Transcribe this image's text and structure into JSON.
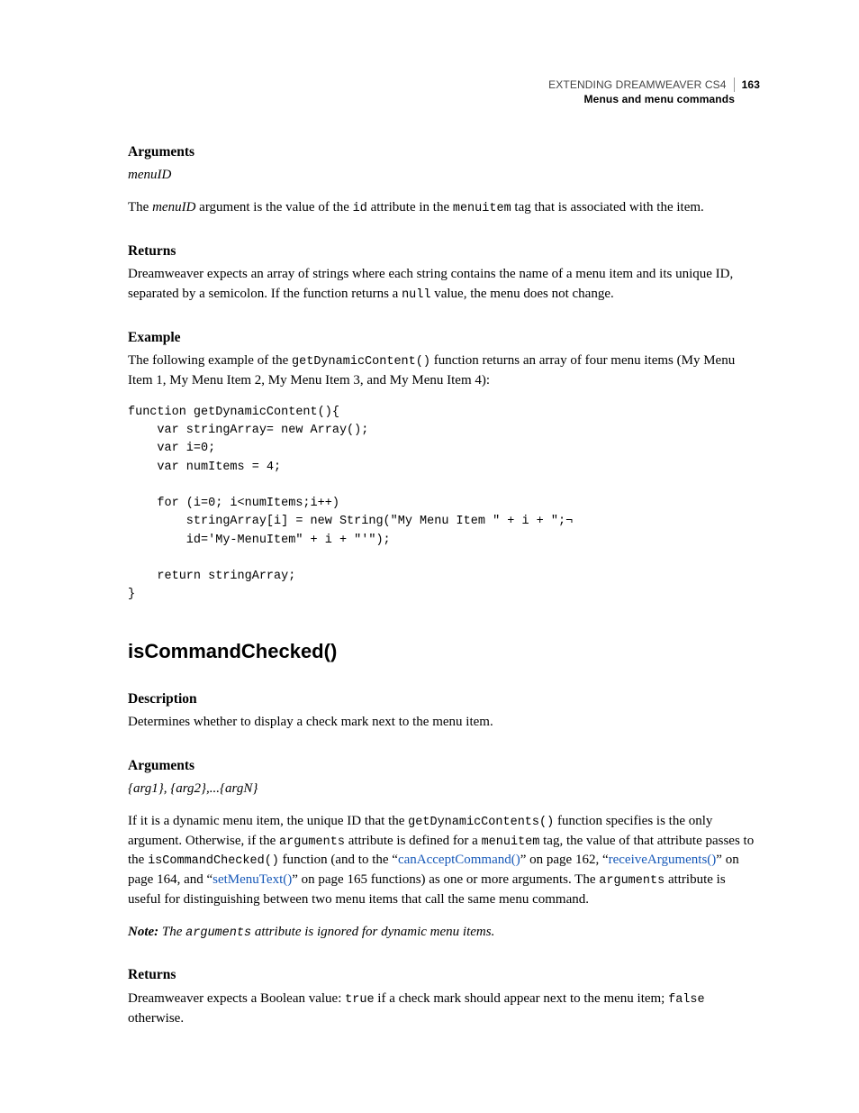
{
  "header": {
    "doc_title": "EXTENDING DREAMWEAVER CS4",
    "page_number": "163",
    "section": "Menus and menu commands"
  },
  "sec1": {
    "heading1": "Arguments",
    "arg_name": "menuID",
    "para1_a": "The ",
    "para1_b": "menuID",
    "para1_c": " argument is the value of the ",
    "para1_d": "id",
    "para1_e": " attribute in the ",
    "para1_f": "menuitem",
    "para1_g": " tag that is associated with the item.",
    "heading2": "Returns",
    "returns_a": "Dreamweaver expects an array of strings where each string contains the name of a menu item and its unique ID, separated by a semicolon. If the function returns a ",
    "returns_b": "null",
    "returns_c": " value, the menu does not change.",
    "heading3": "Example",
    "example_a": "The following example of the ",
    "example_b": "getDynamicContent()",
    "example_c": " function returns an array of four menu items (My Menu Item 1, My Menu Item 2, My Menu Item 3, and My Menu Item 4):",
    "code": "function getDynamicContent(){\n    var stringArray= new Array();\n    var i=0;\n    var numItems = 4;\n\n    for (i=0; i<numItems;i++)\n        stringArray[i] = new String(\"My Menu Item \" + i + \";¬\n        id='My-MenuItem\" + i + \"'\");\n\n    return stringArray;\n}"
  },
  "sec2": {
    "title": "isCommandChecked()",
    "heading1": "Description",
    "desc": "Determines whether to display a check mark next to the menu item.",
    "heading2": "Arguments",
    "args_sig": "{arg1}, {arg2},...{argN}",
    "p1_a": "If it is a dynamic menu item, the unique ID that the ",
    "p1_b": "getDynamicContents()",
    "p1_c": " function specifies is the only argument. Otherwise, if the ",
    "p1_d": "arguments",
    "p1_e": " attribute is defined for a ",
    "p1_f": "menuitem",
    "p1_g": " tag, the value of that attribute passes to the ",
    "p1_h": "isCommandChecked()",
    "p1_i": " function (and to the “",
    "link1": "canAcceptCommand()",
    "p1_j": "” on page 162, “",
    "link2": "receiveArguments()",
    "p1_k": "” on page 164, and “",
    "link3": "setMenuText()",
    "p1_l": "” on page 165 functions) as one or more arguments. The ",
    "p1_m": "arguments",
    "p1_n": " attribute is useful for distinguishing between two menu items that call the same menu command.",
    "note_lead": "Note:",
    "note_a": " The ",
    "note_b": "arguments",
    "note_c": " attribute is ignored for dynamic menu items.",
    "heading3": "Returns",
    "ret_a": "Dreamweaver expects a Boolean value: ",
    "ret_b": "true",
    "ret_c": " if a check mark should appear next to the menu item; ",
    "ret_d": "false",
    "ret_e": " otherwise."
  }
}
